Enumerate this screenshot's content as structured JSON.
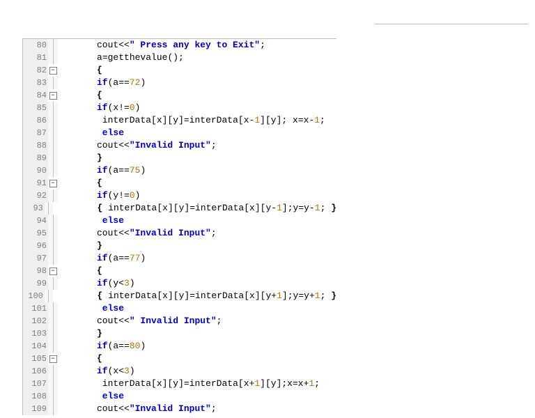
{
  "lines": [
    {
      "n": 80,
      "fold": "",
      "indent": 3,
      "tokens": [
        {
          "t": "id",
          "v": "cout"
        },
        {
          "t": "sym",
          "v": "<<"
        },
        {
          "t": "str",
          "v": "\" Press any key to Exit\""
        },
        {
          "t": "sym",
          "v": ";"
        }
      ]
    },
    {
      "n": 81,
      "fold": "",
      "indent": 3,
      "tokens": [
        {
          "t": "id",
          "v": "a"
        },
        {
          "t": "sym",
          "v": "="
        },
        {
          "t": "id",
          "v": "getthevalue"
        },
        {
          "t": "sym",
          "v": "();"
        }
      ]
    },
    {
      "n": 82,
      "fold": "minus",
      "indent": 3,
      "tokens": [
        {
          "t": "brace",
          "v": "{"
        }
      ]
    },
    {
      "n": 83,
      "fold": "",
      "indent": 3,
      "tokens": [
        {
          "t": "kw",
          "v": "if"
        },
        {
          "t": "sym",
          "v": "("
        },
        {
          "t": "id",
          "v": "a"
        },
        {
          "t": "sym",
          "v": "=="
        },
        {
          "t": "num",
          "v": "72"
        },
        {
          "t": "sym",
          "v": ")"
        }
      ]
    },
    {
      "n": 84,
      "fold": "minus",
      "indent": 3,
      "tokens": [
        {
          "t": "brace",
          "v": "{"
        }
      ]
    },
    {
      "n": 85,
      "fold": "",
      "indent": 3,
      "tokens": [
        {
          "t": "kw",
          "v": "if"
        },
        {
          "t": "sym",
          "v": "("
        },
        {
          "t": "id",
          "v": "x"
        },
        {
          "t": "sym",
          "v": "!="
        },
        {
          "t": "num",
          "v": "0"
        },
        {
          "t": "sym",
          "v": ")"
        }
      ]
    },
    {
      "n": 86,
      "fold": "",
      "indent": 3,
      "guide": true,
      "tokens": [
        {
          "t": "id",
          "v": " interData"
        },
        {
          "t": "sym",
          "v": "["
        },
        {
          "t": "id",
          "v": "x"
        },
        {
          "t": "sym",
          "v": "]["
        },
        {
          "t": "id",
          "v": "y"
        },
        {
          "t": "sym",
          "v": "]="
        },
        {
          "t": "id",
          "v": "interData"
        },
        {
          "t": "sym",
          "v": "["
        },
        {
          "t": "id",
          "v": "x"
        },
        {
          "t": "sym",
          "v": "-"
        },
        {
          "t": "num",
          "v": "1"
        },
        {
          "t": "sym",
          "v": "]["
        },
        {
          "t": "id",
          "v": "y"
        },
        {
          "t": "sym",
          "v": "]; "
        },
        {
          "t": "id",
          "v": "x"
        },
        {
          "t": "sym",
          "v": "="
        },
        {
          "t": "id",
          "v": "x"
        },
        {
          "t": "sym",
          "v": "-"
        },
        {
          "t": "num",
          "v": "1"
        },
        {
          "t": "sym",
          "v": ";"
        }
      ]
    },
    {
      "n": 87,
      "fold": "",
      "indent": 3,
      "guide": true,
      "tokens": [
        {
          "t": "kw",
          "v": " else"
        }
      ]
    },
    {
      "n": 88,
      "fold": "",
      "indent": 3,
      "tokens": [
        {
          "t": "id",
          "v": "cout"
        },
        {
          "t": "sym",
          "v": "<<"
        },
        {
          "t": "str",
          "v": "\"Invalid Input\""
        },
        {
          "t": "sym",
          "v": ";"
        }
      ]
    },
    {
      "n": 89,
      "fold": "",
      "indent": 3,
      "tokens": [
        {
          "t": "brace",
          "v": "}"
        }
      ]
    },
    {
      "n": 90,
      "fold": "",
      "indent": 3,
      "tokens": [
        {
          "t": "kw",
          "v": "if"
        },
        {
          "t": "sym",
          "v": "("
        },
        {
          "t": "id",
          "v": "a"
        },
        {
          "t": "sym",
          "v": "=="
        },
        {
          "t": "num",
          "v": "75"
        },
        {
          "t": "sym",
          "v": ")"
        }
      ]
    },
    {
      "n": 91,
      "fold": "minus",
      "indent": 3,
      "tokens": [
        {
          "t": "brace",
          "v": "{"
        }
      ]
    },
    {
      "n": 92,
      "fold": "",
      "indent": 3,
      "tokens": [
        {
          "t": "kw",
          "v": "if"
        },
        {
          "t": "sym",
          "v": "("
        },
        {
          "t": "id",
          "v": "y"
        },
        {
          "t": "sym",
          "v": "!="
        },
        {
          "t": "num",
          "v": "0"
        },
        {
          "t": "sym",
          "v": ")"
        }
      ]
    },
    {
      "n": 93,
      "fold": "",
      "indent": 3,
      "guide": true,
      "tokens": [
        {
          "t": "brace",
          "v": " { "
        },
        {
          "t": "id",
          "v": "interData"
        },
        {
          "t": "sym",
          "v": "["
        },
        {
          "t": "id",
          "v": "x"
        },
        {
          "t": "sym",
          "v": "]["
        },
        {
          "t": "id",
          "v": "y"
        },
        {
          "t": "sym",
          "v": "]="
        },
        {
          "t": "id",
          "v": "interData"
        },
        {
          "t": "sym",
          "v": "["
        },
        {
          "t": "id",
          "v": "x"
        },
        {
          "t": "sym",
          "v": "]["
        },
        {
          "t": "id",
          "v": "y"
        },
        {
          "t": "sym",
          "v": "-"
        },
        {
          "t": "num",
          "v": "1"
        },
        {
          "t": "sym",
          "v": "];"
        },
        {
          "t": "id",
          "v": "y"
        },
        {
          "t": "sym",
          "v": "="
        },
        {
          "t": "id",
          "v": "y"
        },
        {
          "t": "sym",
          "v": "-"
        },
        {
          "t": "num",
          "v": "1"
        },
        {
          "t": "sym",
          "v": "; "
        },
        {
          "t": "brace",
          "v": "}"
        }
      ]
    },
    {
      "n": 94,
      "fold": "",
      "indent": 3,
      "guide": true,
      "tokens": [
        {
          "t": "kw",
          "v": " else"
        }
      ]
    },
    {
      "n": 95,
      "fold": "",
      "indent": 3,
      "tokens": [
        {
          "t": "id",
          "v": "cout"
        },
        {
          "t": "sym",
          "v": "<<"
        },
        {
          "t": "str",
          "v": "\"Invalid Input\""
        },
        {
          "t": "sym",
          "v": ";"
        }
      ]
    },
    {
      "n": 96,
      "fold": "",
      "indent": 3,
      "tokens": [
        {
          "t": "brace",
          "v": "}"
        }
      ]
    },
    {
      "n": 97,
      "fold": "",
      "indent": 3,
      "tokens": [
        {
          "t": "kw",
          "v": "if"
        },
        {
          "t": "sym",
          "v": "("
        },
        {
          "t": "id",
          "v": "a"
        },
        {
          "t": "sym",
          "v": "=="
        },
        {
          "t": "num",
          "v": "77"
        },
        {
          "t": "sym",
          "v": ")"
        }
      ]
    },
    {
      "n": 98,
      "fold": "minus",
      "indent": 3,
      "tokens": [
        {
          "t": "brace",
          "v": "{"
        }
      ]
    },
    {
      "n": 99,
      "fold": "",
      "indent": 3,
      "tokens": [
        {
          "t": "kw",
          "v": "if"
        },
        {
          "t": "sym",
          "v": "("
        },
        {
          "t": "id",
          "v": "y"
        },
        {
          "t": "sym",
          "v": "<"
        },
        {
          "t": "num",
          "v": "3"
        },
        {
          "t": "sym",
          "v": ")"
        }
      ]
    },
    {
      "n": 100,
      "fold": "",
      "indent": 3,
      "guide": true,
      "tokens": [
        {
          "t": "brace",
          "v": " { "
        },
        {
          "t": "id",
          "v": "interData"
        },
        {
          "t": "sym",
          "v": "["
        },
        {
          "t": "id",
          "v": "x"
        },
        {
          "t": "sym",
          "v": "]["
        },
        {
          "t": "id",
          "v": "y"
        },
        {
          "t": "sym",
          "v": "]="
        },
        {
          "t": "id",
          "v": "interData"
        },
        {
          "t": "sym",
          "v": "["
        },
        {
          "t": "id",
          "v": "x"
        },
        {
          "t": "sym",
          "v": "]["
        },
        {
          "t": "id",
          "v": "y"
        },
        {
          "t": "sym",
          "v": "+"
        },
        {
          "t": "num",
          "v": "1"
        },
        {
          "t": "sym",
          "v": "];"
        },
        {
          "t": "id",
          "v": "y"
        },
        {
          "t": "sym",
          "v": "="
        },
        {
          "t": "id",
          "v": "y"
        },
        {
          "t": "sym",
          "v": "+"
        },
        {
          "t": "num",
          "v": "1"
        },
        {
          "t": "sym",
          "v": "; "
        },
        {
          "t": "brace",
          "v": "}"
        }
      ]
    },
    {
      "n": 101,
      "fold": "",
      "indent": 3,
      "guide": true,
      "tokens": [
        {
          "t": "kw",
          "v": " else"
        }
      ]
    },
    {
      "n": 102,
      "fold": "",
      "indent": 3,
      "tokens": [
        {
          "t": "id",
          "v": "cout"
        },
        {
          "t": "sym",
          "v": "<<"
        },
        {
          "t": "str",
          "v": "\" Invalid Input\""
        },
        {
          "t": "sym",
          "v": ";"
        }
      ]
    },
    {
      "n": 103,
      "fold": "",
      "indent": 3,
      "tokens": [
        {
          "t": "brace",
          "v": "}"
        }
      ]
    },
    {
      "n": 104,
      "fold": "",
      "indent": 3,
      "tokens": [
        {
          "t": "kw",
          "v": "if"
        },
        {
          "t": "sym",
          "v": "("
        },
        {
          "t": "id",
          "v": "a"
        },
        {
          "t": "sym",
          "v": "=="
        },
        {
          "t": "num",
          "v": "80"
        },
        {
          "t": "sym",
          "v": ")"
        }
      ]
    },
    {
      "n": 105,
      "fold": "minus",
      "indent": 3,
      "tokens": [
        {
          "t": "brace",
          "v": "{"
        }
      ]
    },
    {
      "n": 106,
      "fold": "",
      "indent": 3,
      "tokens": [
        {
          "t": "kw",
          "v": "if"
        },
        {
          "t": "sym",
          "v": "("
        },
        {
          "t": "id",
          "v": "x"
        },
        {
          "t": "sym",
          "v": "<"
        },
        {
          "t": "num",
          "v": "3"
        },
        {
          "t": "sym",
          "v": ")"
        }
      ]
    },
    {
      "n": 107,
      "fold": "",
      "indent": 3,
      "guide": true,
      "tokens": [
        {
          "t": "id",
          "v": " interData"
        },
        {
          "t": "sym",
          "v": "["
        },
        {
          "t": "id",
          "v": "x"
        },
        {
          "t": "sym",
          "v": "]["
        },
        {
          "t": "id",
          "v": "y"
        },
        {
          "t": "sym",
          "v": "]="
        },
        {
          "t": "id",
          "v": "interData"
        },
        {
          "t": "sym",
          "v": "["
        },
        {
          "t": "id",
          "v": "x"
        },
        {
          "t": "sym",
          "v": "+"
        },
        {
          "t": "num",
          "v": "1"
        },
        {
          "t": "sym",
          "v": "]["
        },
        {
          "t": "id",
          "v": "y"
        },
        {
          "t": "sym",
          "v": "];"
        },
        {
          "t": "id",
          "v": "x"
        },
        {
          "t": "sym",
          "v": "="
        },
        {
          "t": "id",
          "v": "x"
        },
        {
          "t": "sym",
          "v": "+"
        },
        {
          "t": "num",
          "v": "1"
        },
        {
          "t": "sym",
          "v": ";"
        }
      ]
    },
    {
      "n": 108,
      "fold": "",
      "indent": 3,
      "guide": true,
      "tokens": [
        {
          "t": "kw",
          "v": " else"
        }
      ]
    },
    {
      "n": 109,
      "fold": "",
      "indent": 3,
      "tokens": [
        {
          "t": "id",
          "v": "cout"
        },
        {
          "t": "sym",
          "v": "<<"
        },
        {
          "t": "str",
          "v": "\"Invalid Input\""
        },
        {
          "t": "sym",
          "v": ";"
        }
      ]
    }
  ],
  "fold_glyph": "−"
}
